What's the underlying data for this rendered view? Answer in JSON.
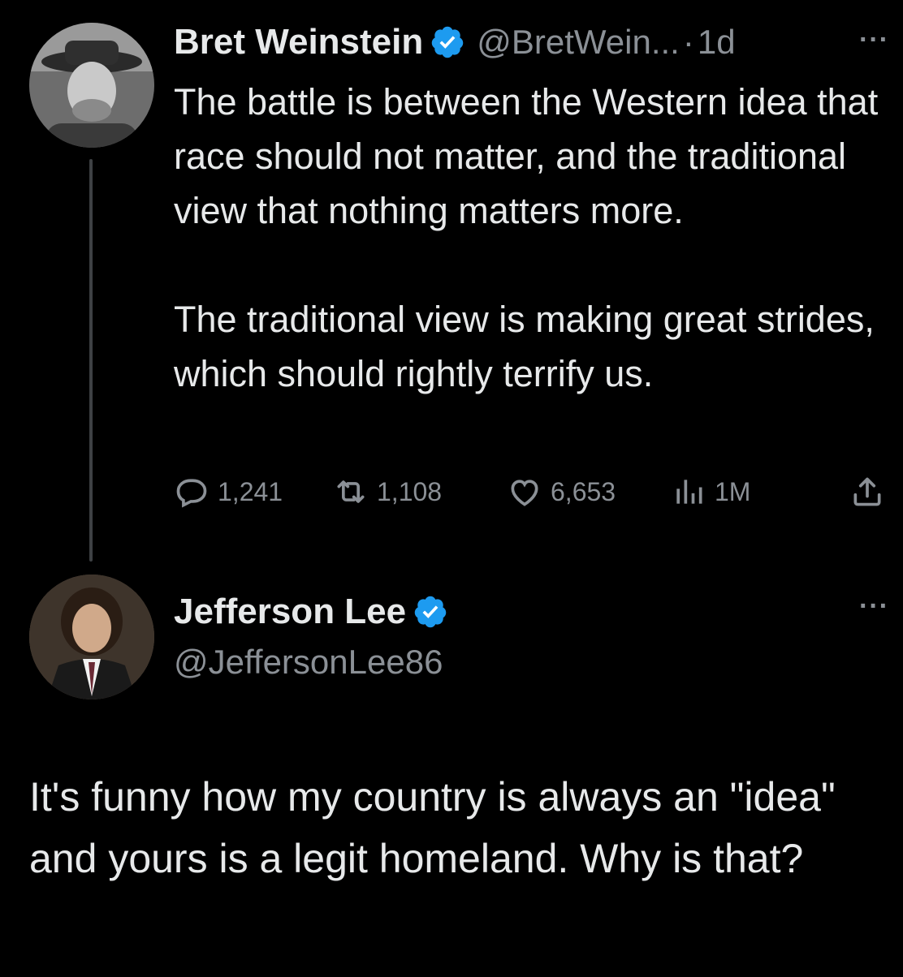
{
  "original_tweet": {
    "author": {
      "display_name": "Bret Weinstein",
      "handle": "@BretWein...",
      "verified": true
    },
    "separator": "·",
    "time": "1d",
    "more_label": "···",
    "text_paragraphs": [
      "The battle is between the Western idea that race should not matter, and the traditional view that nothing matters more.",
      "The traditional view is making great strides, which should rightly terrify us."
    ],
    "stats": {
      "replies": "1,241",
      "retweets": "1,108",
      "likes": "6,653",
      "views": "1M"
    }
  },
  "reply_tweet": {
    "author": {
      "display_name": "Jefferson Lee",
      "handle": "@JeffersonLee86",
      "verified": true
    },
    "more_label": "···",
    "text": "It's funny how my country is always an \"idea\" and yours is a legit homeland. Why is that?"
  },
  "colors": {
    "background": "#000000",
    "text_primary": "#e7e9ea",
    "text_secondary": "#8b9096",
    "verified_blue": "#1d9bf0",
    "thread_line": "#3e4144"
  },
  "icons": {
    "reply": "reply-bubble-icon",
    "retweet": "retweet-icon",
    "like": "heart-icon",
    "views": "bar-chart-icon",
    "share": "share-upload-icon",
    "verified": "verified-badge-icon"
  }
}
